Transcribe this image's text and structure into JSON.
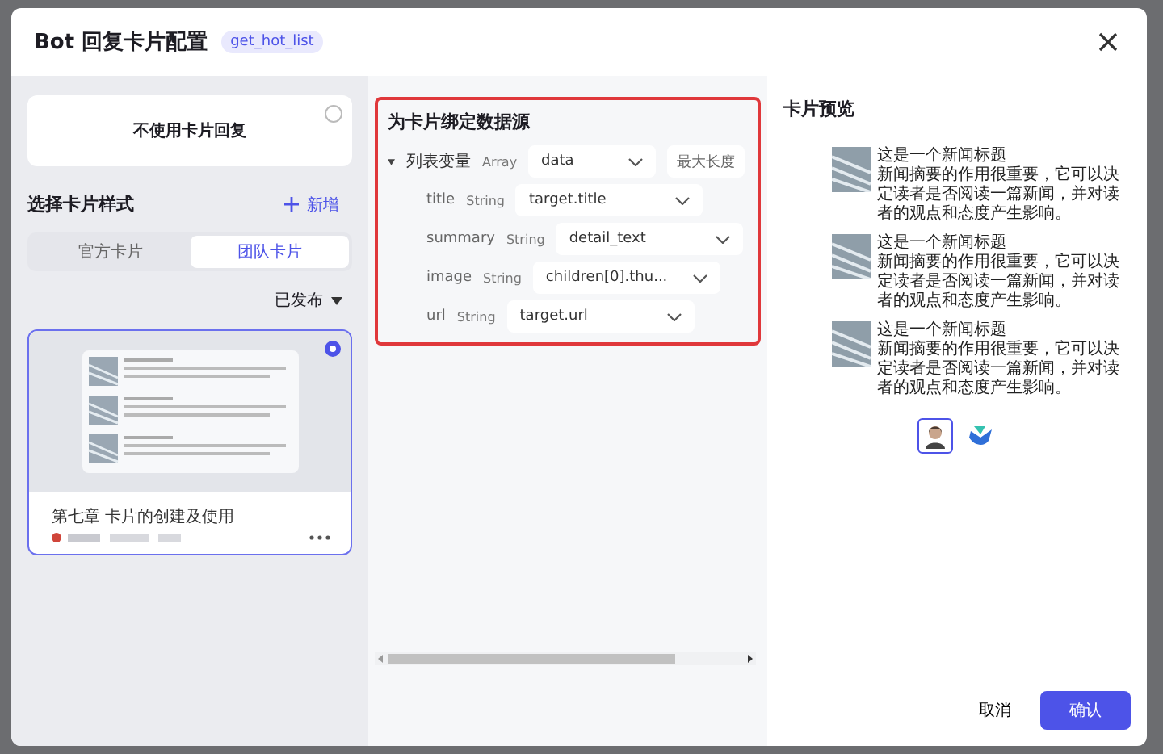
{
  "dialog": {
    "title": "Bot 回复卡片配置",
    "tag": "get_hot_list"
  },
  "no_card_option": {
    "label": "不使用卡片回复",
    "selected": false
  },
  "style_section": {
    "title": "选择卡片样式",
    "add_label": "新增",
    "filter": "已发布",
    "tabs": [
      {
        "label": "官方卡片",
        "selected": false
      },
      {
        "label": "团队卡片",
        "selected": true
      }
    ],
    "cards": [
      {
        "title": "第七章 卡片的创建及使用",
        "selected": true
      }
    ]
  },
  "binding": {
    "title": "为卡片绑定数据源",
    "list_variable": {
      "name": "列表变量",
      "type": "Array",
      "value": "data",
      "expanded": true,
      "max_length_label": "最大长度"
    },
    "fields": [
      {
        "name": "title",
        "type": "String",
        "value": "target.title"
      },
      {
        "name": "summary",
        "type": "String",
        "value": "detail_text"
      },
      {
        "name": "image",
        "type": "String",
        "value": "children[0].thu..."
      },
      {
        "name": "url",
        "type": "String",
        "value": "target.url"
      }
    ]
  },
  "preview": {
    "title": "卡片预览",
    "items": [
      {
        "title": "这是一个新闻标题",
        "summary": "新闻摘要的作用很重要，它可以决定读者是否阅读一篇新闻，并对读者的观点和态度产生影响。"
      },
      {
        "title": "这是一个新闻标题",
        "summary": "新闻摘要的作用很重要，它可以决定读者是否阅读一篇新闻，并对读者的观点和态度产生影响。"
      },
      {
        "title": "这是一个新闻标题",
        "summary": "新闻摘要的作用很重要，它可以决定读者是否阅读一篇新闻，并对读者的观点和态度产生影响。"
      }
    ],
    "avatars": [
      {
        "kind": "person",
        "selected": true
      },
      {
        "kind": "logo",
        "selected": false
      }
    ]
  },
  "footer": {
    "cancel": "取消",
    "confirm": "确认"
  }
}
